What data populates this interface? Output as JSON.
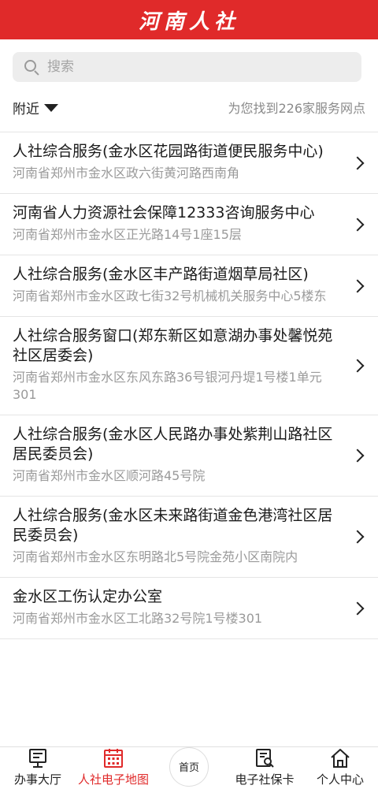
{
  "header": {
    "title": "河南人社"
  },
  "search": {
    "placeholder": "搜索"
  },
  "filter": {
    "label": "附近",
    "result_text": "为您找到226家服务网点"
  },
  "items": [
    {
      "title": "人社综合服务(金水区花园路街道便民服务中心)",
      "address": "河南省郑州市金水区政六街黄河路西南角"
    },
    {
      "title": "河南省人力资源社会保障12333咨询服务中心",
      "address": "河南省郑州市金水区正光路14号1座15层"
    },
    {
      "title": "人社综合服务(金水区丰产路街道烟草局社区)",
      "address": "河南省郑州市金水区政七街32号机械机关服务中心5楼东"
    },
    {
      "title": "人社综合服务窗口(郑东新区如意湖办事处馨悦苑社区居委会)",
      "address": "河南省郑州市金水区东风东路36号银河丹堤1号楼1单元301"
    },
    {
      "title": "人社综合服务(金水区人民路办事处紫荆山路社区居民委员会)",
      "address": "河南省郑州市金水区顺河路45号院"
    },
    {
      "title": "人社综合服务(金水区未来路街道金色港湾社区居民委员会)",
      "address": "河南省郑州市金水区东明路北5号院金苑小区南院内"
    },
    {
      "title": "金水区工伤认定办公室",
      "address": "河南省郑州市金水区工北路32号院1号楼301"
    }
  ],
  "tabs": [
    {
      "label": "办事大厅",
      "icon": "monitor-icon"
    },
    {
      "label": "人社电子地图",
      "icon": "calendar-map-icon",
      "active": true
    },
    {
      "label": "首页",
      "icon": "home-circle"
    },
    {
      "label": "电子社保卡",
      "icon": "card-search-icon"
    },
    {
      "label": "个人中心",
      "icon": "house-icon"
    }
  ],
  "colors": {
    "brand": "#e02a2a",
    "text": "#222222",
    "muted": "#9a9a9a"
  }
}
